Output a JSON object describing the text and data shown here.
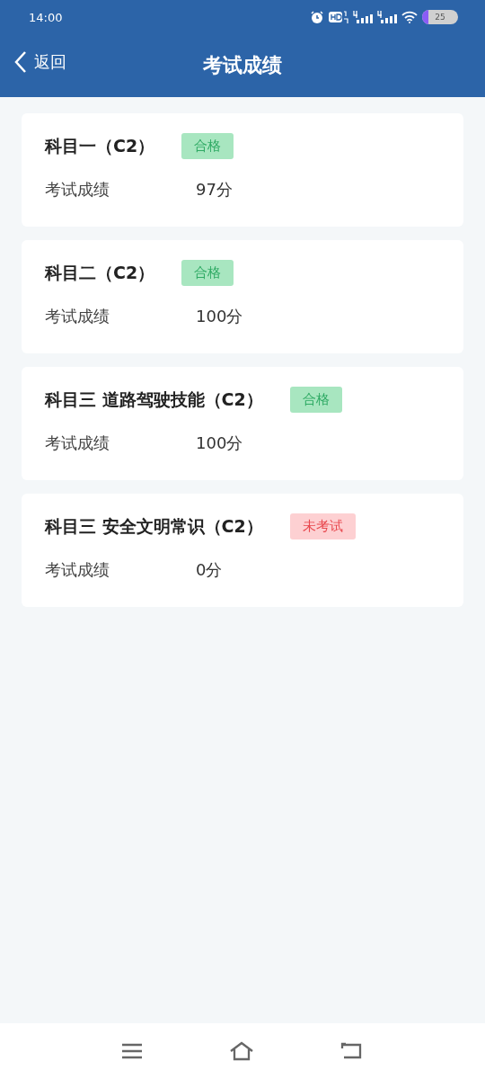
{
  "status_bar": {
    "time": "14:00",
    "battery": "25"
  },
  "header": {
    "back": "返回",
    "title": "考试成绩"
  },
  "results": [
    {
      "subject": "科目一（C2）",
      "status": {
        "label": "合格",
        "kind": "pass"
      },
      "score_label": "考试成绩",
      "score": "97分"
    },
    {
      "subject": "科目二（C2）",
      "status": {
        "label": "合格",
        "kind": "pass"
      },
      "score_label": "考试成绩",
      "score": "100分"
    },
    {
      "subject": "科目三 道路驾驶技能（C2）",
      "status": {
        "label": "合格",
        "kind": "pass"
      },
      "score_label": "考试成绩",
      "score": "100分"
    },
    {
      "subject": "科目三 安全文明常识（C2）",
      "status": {
        "label": "未考试",
        "kind": "absent"
      },
      "score_label": "考试成绩",
      "score": "0分"
    }
  ]
}
